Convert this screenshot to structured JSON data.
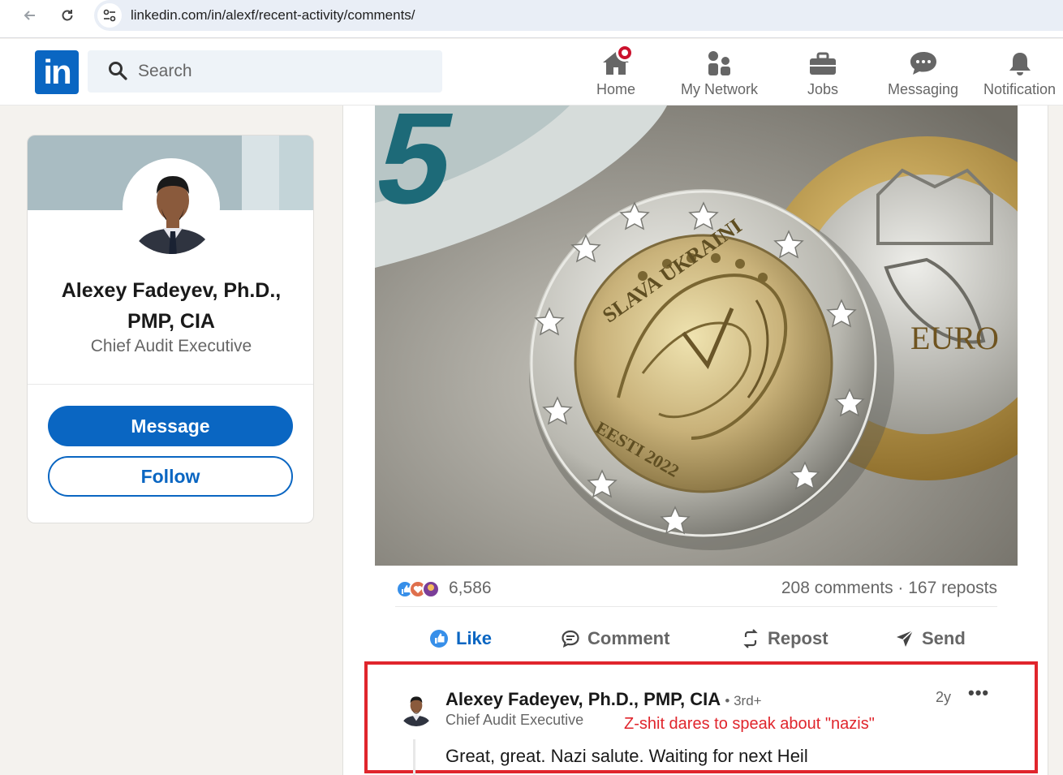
{
  "browser": {
    "url": "linkedin.com/in/alexf/recent-activity/comments/"
  },
  "header": {
    "search_placeholder": "Search",
    "nav": [
      {
        "label": "Home",
        "icon": "home-icon"
      },
      {
        "label": "My Network",
        "icon": "network-icon"
      },
      {
        "label": "Jobs",
        "icon": "briefcase-icon"
      },
      {
        "label": "Messaging",
        "icon": "messaging-icon"
      },
      {
        "label": "Notification",
        "icon": "bell-icon"
      }
    ],
    "logo": "in"
  },
  "profile": {
    "name": "Alexey Fadeyev, Ph.D., PMP, CIA",
    "headline": "Chief Audit Executive",
    "message_label": "Message",
    "follow_label": "Follow"
  },
  "post": {
    "image_text": {
      "coin_inscription": "SLAVA UKRAINI",
      "coin_country": "EESTI 2022",
      "banknote_digit": "5",
      "second_coin": "EURO"
    },
    "reaction_count": "6,586",
    "meta": "208 comments · 167 reposts",
    "actions": {
      "like": "Like",
      "comment": "Comment",
      "repost": "Repost",
      "send": "Send"
    }
  },
  "comment": {
    "author": "Alexey Fadeyev, Ph.D., PMP, CIA",
    "degree": "• 3rd+",
    "headline": "Chief Audit Executive",
    "annotation": "Z-shit dares to speak about \"nazis\"",
    "time": "2y",
    "more": "•••",
    "text": "Great, great. Nazi salute. Waiting for next Heil"
  },
  "colors": {
    "linkedin_blue": "#0a66c2",
    "highlight_red": "#e0252c",
    "notification_red": "#cb112d"
  }
}
